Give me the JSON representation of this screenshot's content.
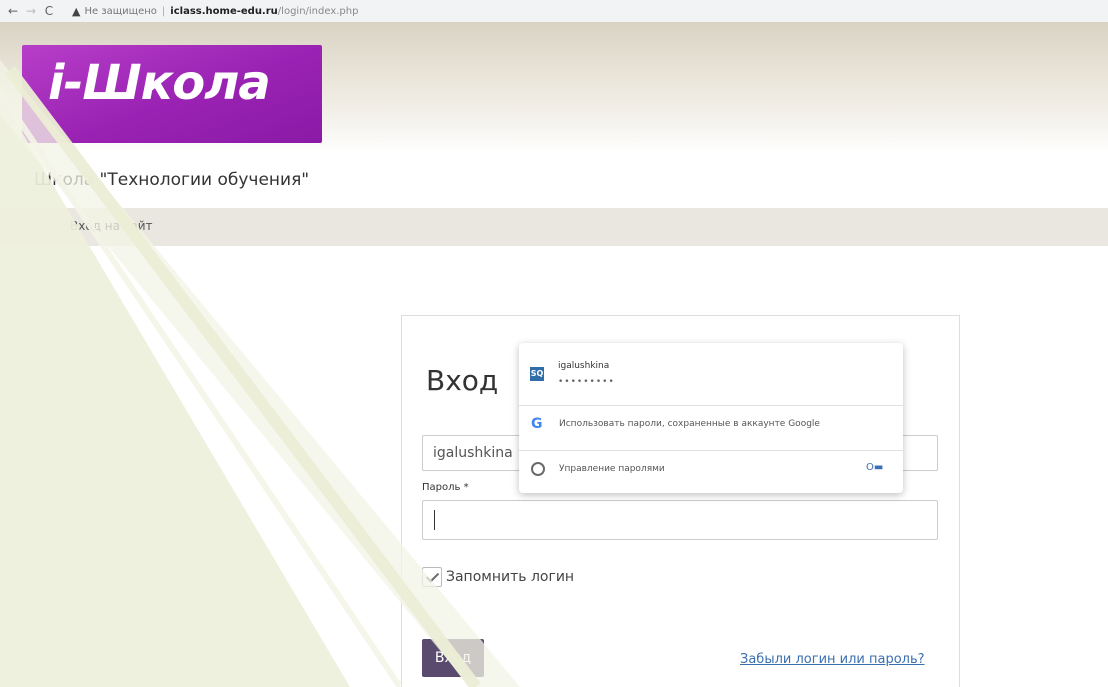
{
  "browser": {
    "back_icon": "←",
    "forward_icon": "→",
    "reload_icon": "C",
    "warning_icon": "▲",
    "insecure_text": "Не защищено",
    "host": "iclass.home-edu.ru",
    "path": "/login/index.php"
  },
  "logo": {
    "text": "i-Школа"
  },
  "site": {
    "title": "Школа \"Технологии обучения\"",
    "breadcrumb": "Вход на сайт"
  },
  "login": {
    "title": "Вход",
    "username_value": "igalushkina",
    "password_label": "Пароль *",
    "remember_label": "Запомнить логин",
    "submit_label": "Вход",
    "forgot_link": "Забыли логин или пароль?"
  },
  "autofill": {
    "site_icon": "SQ",
    "saved_user": "igalushkina",
    "saved_password_mask": "•••••••••",
    "google_icon": "G",
    "use_google_passwords": "Использовать пароли, сохраненные в аккаунте Google",
    "manage_passwords": "Управление паролями",
    "key_icon": "O▬"
  },
  "colors": {
    "logo_purple": "#9a22b3",
    "button": "#5a4a6e",
    "link": "#3a6fb0",
    "overlay_cream": "#f0f1df"
  }
}
